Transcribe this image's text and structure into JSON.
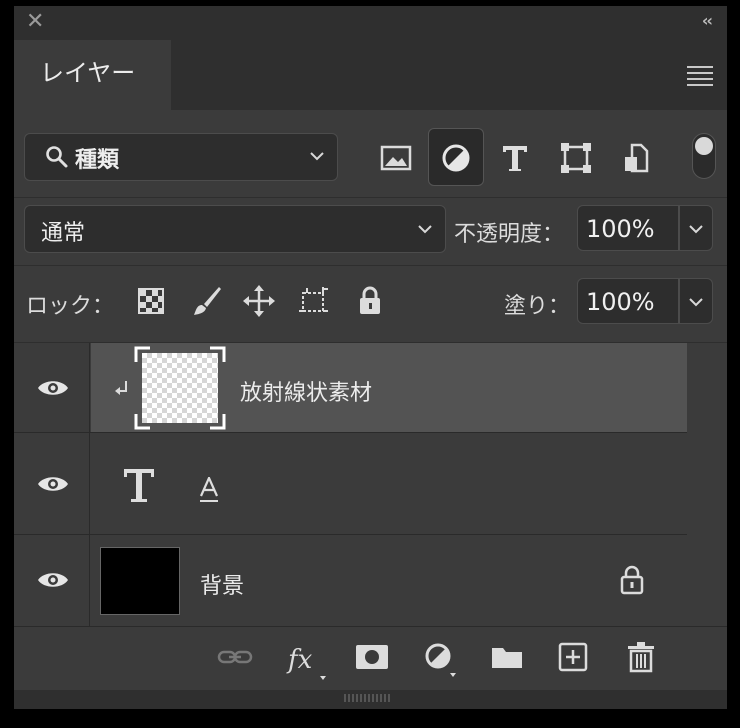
{
  "panel": {
    "tab_label": "レイヤー"
  },
  "filter": {
    "kind_label": "種類"
  },
  "blend": {
    "mode_label": "通常",
    "opacity_label": "不透明度：",
    "opacity_value": "100%",
    "lock_label": "ロック：",
    "fill_label": "塗り：",
    "fill_value": "100%"
  },
  "layers": [
    {
      "name": "放射線状素材",
      "type": "pixel",
      "selected": true,
      "clipped": true
    },
    {
      "name": "",
      "type": "text"
    },
    {
      "name": "背景",
      "type": "background",
      "locked": true
    }
  ],
  "colors": {
    "panel_bg": "#3b3b3b",
    "titlebar_bg": "#2f2f2f",
    "selected_row": "#535353",
    "field_bg": "#2d2d2d"
  }
}
